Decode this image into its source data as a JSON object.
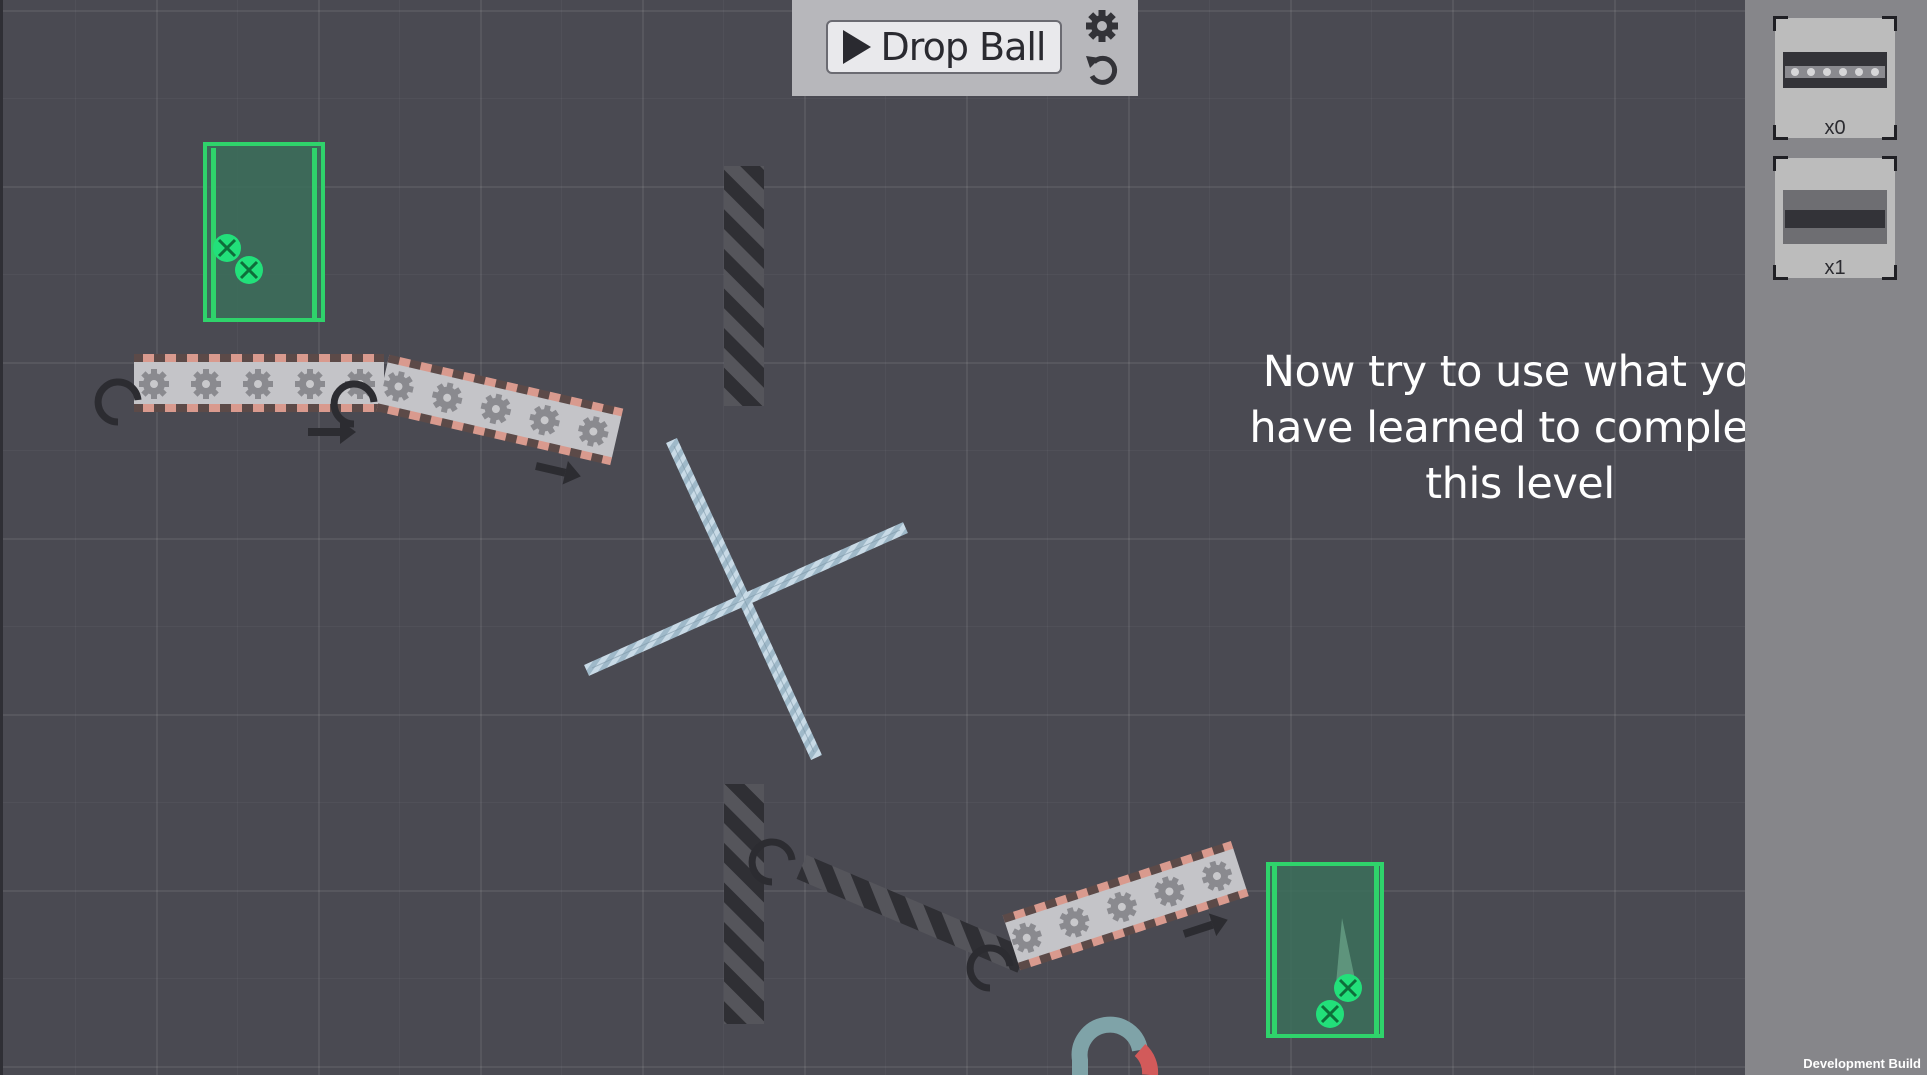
{
  "toolbar": {
    "drop_ball_label": "Drop Ball",
    "play_icon": "play-icon",
    "settings_icon": "gear-icon",
    "reset_icon": "undo-icon"
  },
  "inventory": {
    "slots": [
      {
        "item": "conveyor-belt",
        "count_label": "x0"
      },
      {
        "item": "plank",
        "count_label": "x1"
      }
    ]
  },
  "hint": {
    "text": "Now try to use what you\nhave learned to complete\nthis level"
  },
  "footer": {
    "build_label": "Development Build"
  },
  "colors": {
    "background": "#4a4a52",
    "goal_green": "#2fd36b",
    "ball_green": "#22e07a",
    "conveyor_stripe": "#d99a8e",
    "wall_dark": "#333338",
    "spinner": "#aac2d2",
    "panel": "#86868a"
  }
}
